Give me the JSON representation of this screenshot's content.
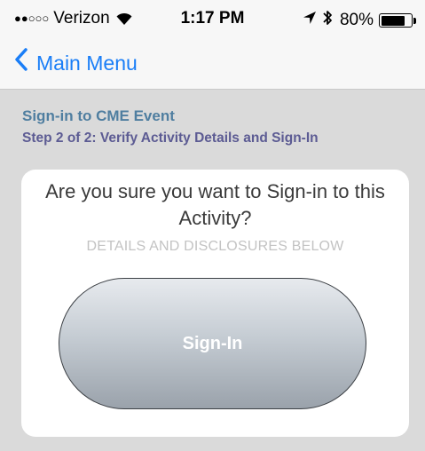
{
  "status_bar": {
    "signal": "●●○○○",
    "carrier": "Verizon",
    "time": "1:17 PM",
    "battery_text": "80%",
    "battery_level": 0.8,
    "icons": [
      "wifi-icon",
      "location-arrow-icon",
      "bluetooth-icon",
      "battery-icon"
    ]
  },
  "nav": {
    "back_label": "Main Menu"
  },
  "page": {
    "title": "Sign-in to CME Event",
    "subtitle": "Step 2 of 2: Verify Activity Details and Sign-In"
  },
  "card": {
    "question": "Are you sure you want to Sign-in to this Activity?",
    "disclosure": "DETAILS AND DISCLOSURES BELOW",
    "signin_label": "Sign-In"
  },
  "colors": {
    "accent": "#1a7ef7",
    "title": "#4f7ea0",
    "subtitle": "#5c5b93",
    "background": "#dadada"
  }
}
